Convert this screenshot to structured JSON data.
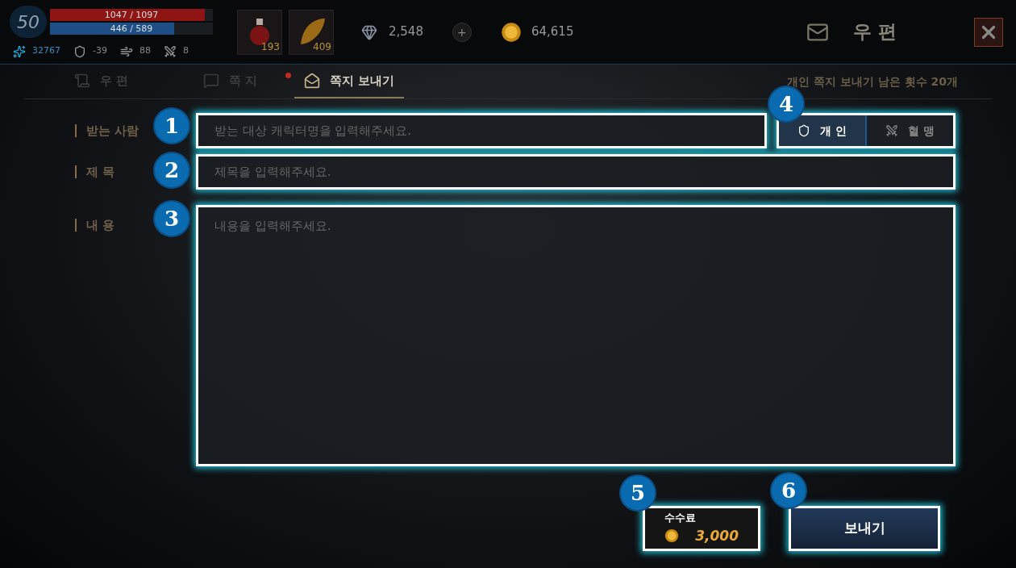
{
  "hud": {
    "level": "50",
    "hp": {
      "text": "1047 / 1097",
      "level": 0.95
    },
    "mp": {
      "text": "446 / 589",
      "level": 0.76
    },
    "stats": [
      {
        "kind": "energy",
        "value": "32767"
      },
      {
        "kind": "defense",
        "value": "-39"
      },
      {
        "kind": "magic",
        "value": "88"
      },
      {
        "kind": "evade",
        "value": "8"
      }
    ]
  },
  "items": [
    {
      "kind": "potion",
      "count": "193"
    },
    {
      "kind": "leaf",
      "count": "409"
    }
  ],
  "currency": [
    {
      "kind": "gem",
      "value": "2,548"
    },
    {
      "kind": "gold",
      "value": "64,615"
    }
  ],
  "add_button": "+",
  "title": "우 편",
  "tabs": [
    {
      "label": "우 편",
      "selected": false,
      "alert": false
    },
    {
      "label": "쪽 지",
      "selected": false,
      "alert": true
    },
    {
      "label": "쪽지 보내기",
      "selected": true,
      "alert": false
    }
  ],
  "remaining": "개인 쪽지 보내기 남은 횟수 20개",
  "form": {
    "recipient": {
      "label": "받는 사람",
      "placeholder": "받는 대상 캐릭터명을 입력해주세요."
    },
    "subject": {
      "label": "제 목",
      "placeholder": "제목을 입력해주세요."
    },
    "content": {
      "label": "내 용",
      "placeholder": "내용을 입력해주세요."
    }
  },
  "recipient_type": [
    {
      "label": "개 인",
      "selected": true
    },
    {
      "label": "혈 맹",
      "selected": false
    }
  ],
  "fee": {
    "label": "수수료",
    "amount": "3,000"
  },
  "send": "보내기",
  "callouts": [
    "1",
    "2",
    "3",
    "4",
    "5",
    "6"
  ]
}
